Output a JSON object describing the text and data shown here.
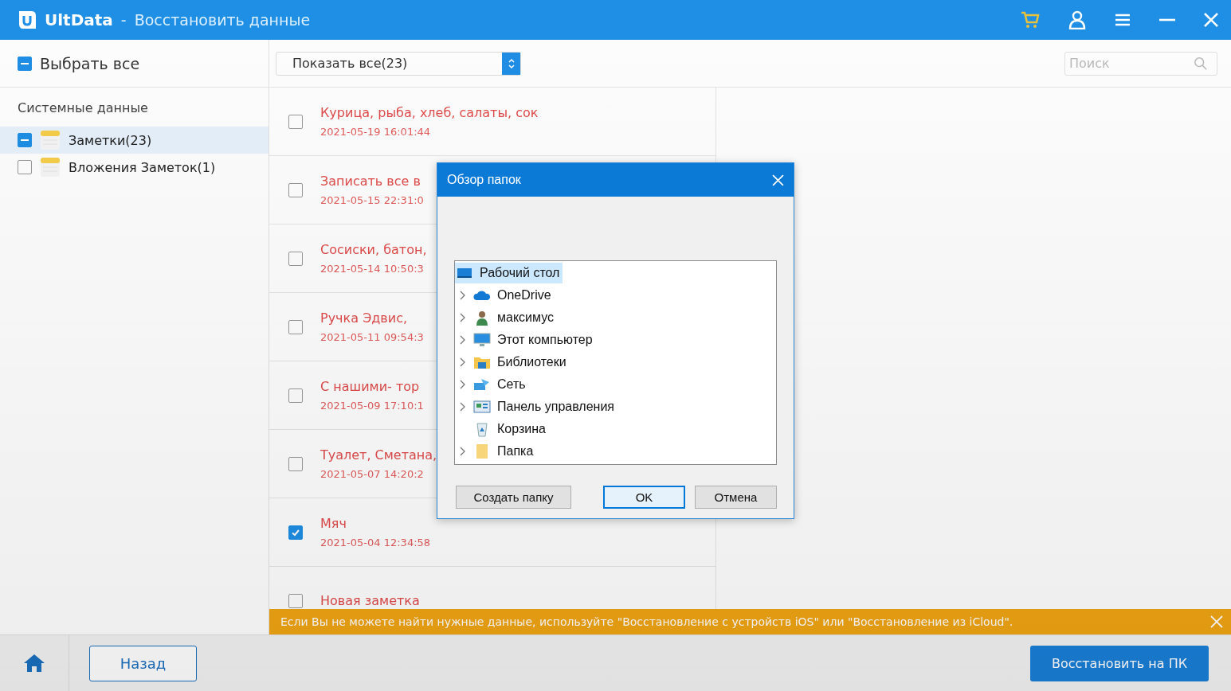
{
  "window": {
    "app_name": "UltData",
    "separator": "-",
    "title": "Восстановить данные"
  },
  "select_all": {
    "label": "Выбрать все",
    "indeterminate": true
  },
  "filter": {
    "value": "Показать все(23)"
  },
  "search": {
    "placeholder": "Поиск"
  },
  "sidebar": {
    "heading": "Системные данные",
    "items": [
      {
        "label": "Заметки(23)",
        "indeterminate": true,
        "selected": true
      },
      {
        "label": "Вложения Заметок(1)",
        "indeterminate": false,
        "selected": false
      }
    ]
  },
  "notes": [
    {
      "title": "Курица, рыба, хлеб, салаты, сок",
      "date": "2021-05-19 16:01:44",
      "checked": false
    },
    {
      "title": "Записать все в",
      "date": "2021-05-15 22:31:0",
      "checked": false
    },
    {
      "title": "Сосиски, батон,",
      "date": "2021-05-14 10:50:3",
      "checked": false
    },
    {
      "title": "Ручка Эдвис,",
      "date": "2021-05-11 09:54:3",
      "checked": false
    },
    {
      "title": "С нашими- тор",
      "date": "2021-05-09 17:10:1",
      "checked": false
    },
    {
      "title": "Туалет, Сметана,",
      "date": "2021-05-07 14:20:2",
      "checked": false
    },
    {
      "title": "Мяч",
      "date": "2021-05-04 12:34:58",
      "checked": true
    },
    {
      "title": "Новая заметка",
      "checked": false
    }
  ],
  "dialog": {
    "title": "Обзор папок",
    "tree": [
      {
        "label": "Рабочий стол",
        "kind": "desktop",
        "has_children": false,
        "selected": true
      },
      {
        "label": "OneDrive",
        "kind": "cloud",
        "has_children": true,
        "selected": false
      },
      {
        "label": "максимус",
        "kind": "user",
        "has_children": true,
        "selected": false
      },
      {
        "label": "Этот компьютер",
        "kind": "computer",
        "has_children": true,
        "selected": false
      },
      {
        "label": "Библиотеки",
        "kind": "library",
        "has_children": true,
        "selected": false
      },
      {
        "label": "Сеть",
        "kind": "network",
        "has_children": true,
        "selected": false
      },
      {
        "label": "Панель управления",
        "kind": "control-panel",
        "has_children": true,
        "selected": false
      },
      {
        "label": "Корзина",
        "kind": "recycle-bin",
        "has_children": false,
        "selected": false
      },
      {
        "label": "Папка",
        "kind": "folder",
        "has_children": true,
        "selected": false
      }
    ],
    "buttons": [
      {
        "label": "Создать папку",
        "kind": "left"
      },
      {
        "label": "OK",
        "kind": "default"
      },
      {
        "label": "Отмена",
        "kind": "normal"
      }
    ]
  },
  "banner": {
    "text": "Если Вы не можете найти нужные данные, используйте \"Восстановление с устройств iOS\" или \"Восстановление из iCloud\"."
  },
  "footer": {
    "back": "Назад",
    "recover": "Восстановить на ПК"
  }
}
